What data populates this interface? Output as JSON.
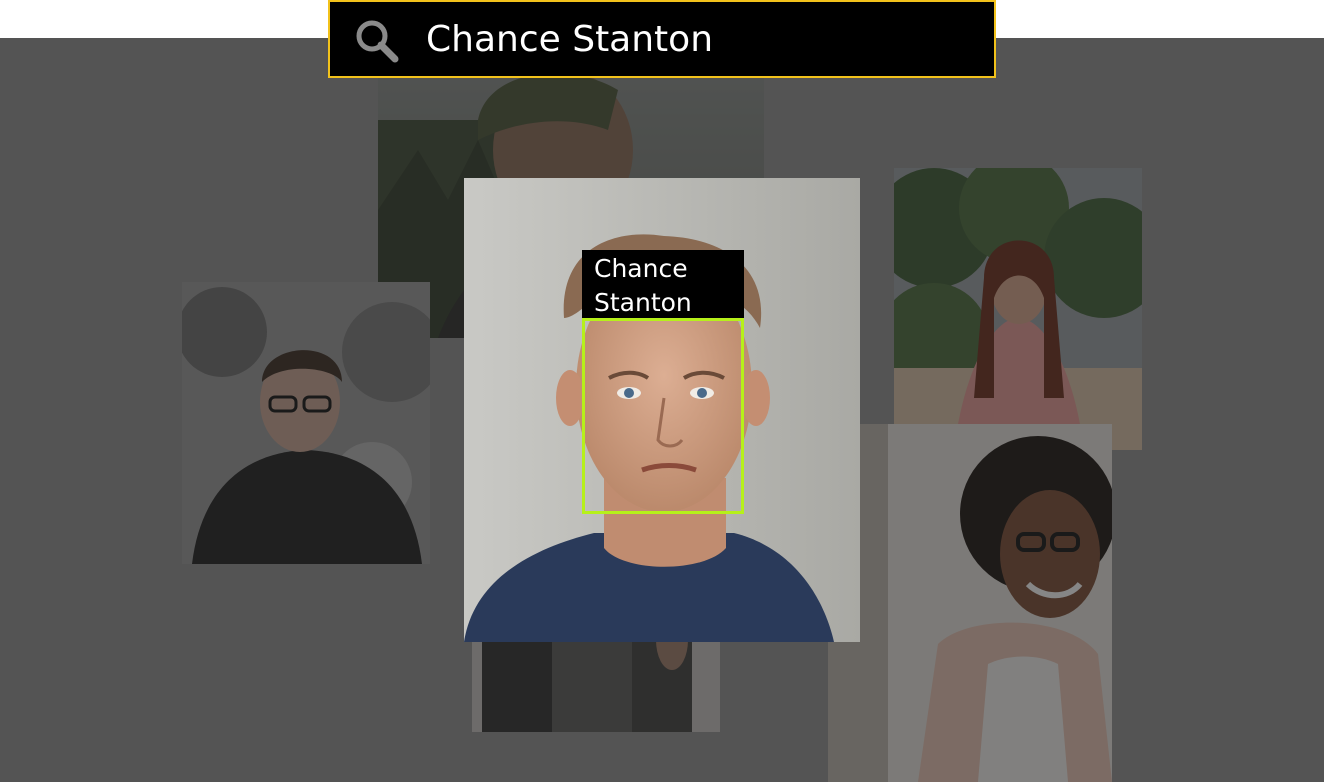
{
  "search": {
    "query": "Chance Stanton",
    "icon": "search-icon"
  },
  "detection": {
    "name_line1": "Chance",
    "name_line2": "Stanton",
    "box_color": "#b6f01a"
  },
  "colors": {
    "search_border": "#f2c21b",
    "backdrop": "#545454"
  }
}
